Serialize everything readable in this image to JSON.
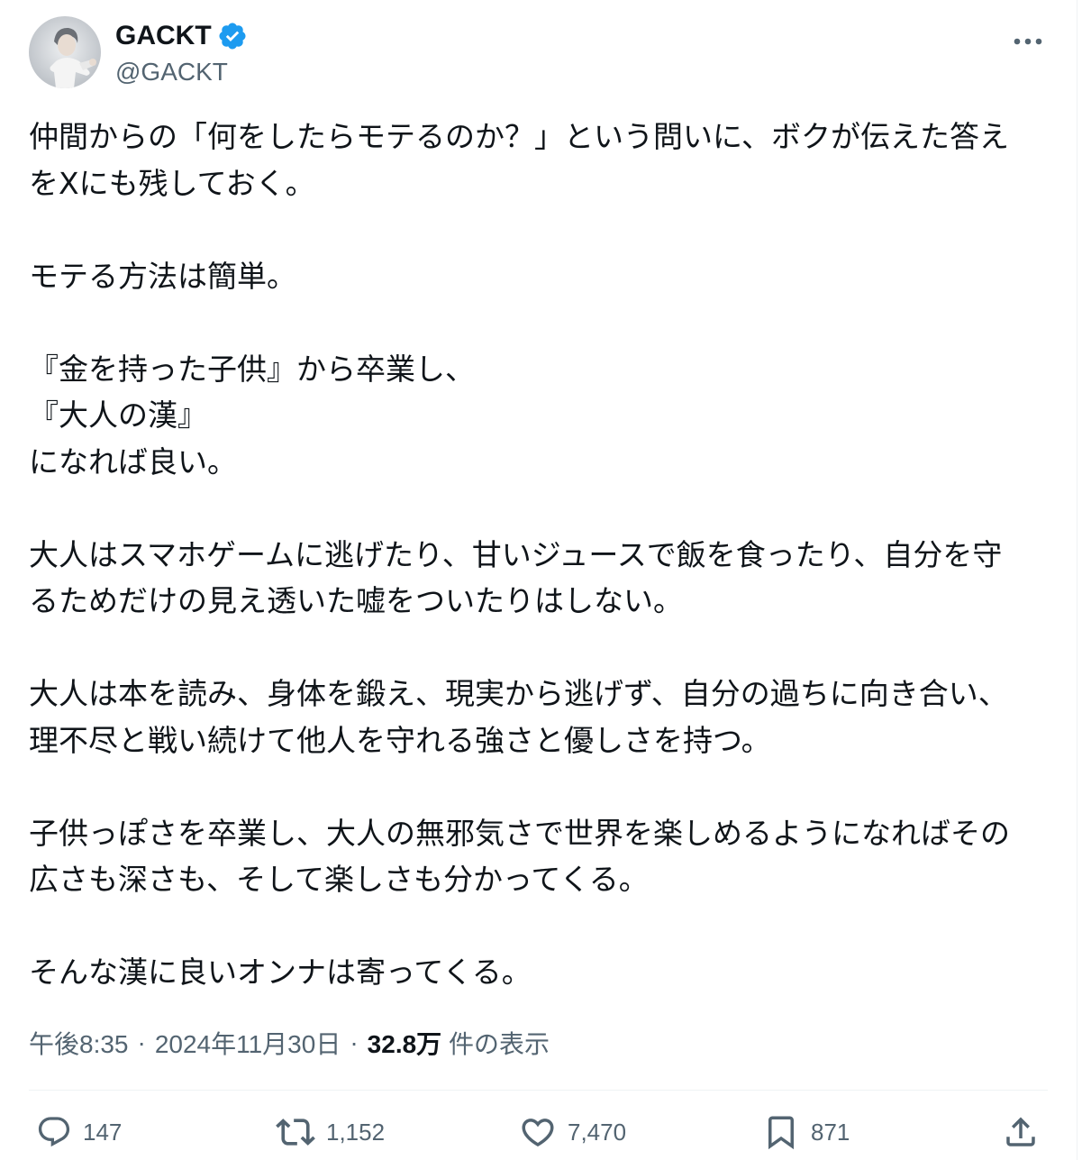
{
  "author": {
    "display_name": "GACKT",
    "handle": "@GACKT",
    "verified": true
  },
  "tweet": {
    "text": "仲間からの「何をしたらモテるのか？」という問いに、ボクが伝えた答え\nをXにも残しておく。\n\nモテる方法は簡単。\n\n『金を持った子供』から卒業し、\n『大人の漢』\nになれば良い。\n\n大人はスマホゲームに逃げたり、甘いジュースで飯を食ったり、自分を守\nるためだけの見え透いた嘘をついたりはしない。\n\n大人は本を読み、身体を鍛え、現実から逃げず、自分の過ちに向き合い、\n理不尽と戦い続けて他人を守れる強さと優しさを持つ。\n\n子供っぽさを卒業し、大人の無邪気さで世界を楽しめるようになればその\n広さも深さも、そして楽しさも分かってくる。\n\nそんな漢に良いオンナは寄ってくる。"
  },
  "meta": {
    "time": "午後8:35",
    "separator1": "·",
    "date": "2024年11月30日",
    "separator2": "·",
    "views_count": "32.8万",
    "views_label": "件の表示"
  },
  "actions": {
    "replies": "147",
    "reposts": "1,152",
    "likes": "7,470",
    "bookmarks": "871"
  },
  "icons": {
    "verified": "verified-badge-icon",
    "more": "more-dots-icon",
    "reply": "reply-icon",
    "repost": "repost-icon",
    "like": "heart-icon",
    "bookmark": "bookmark-icon",
    "share": "share-icon"
  },
  "colors": {
    "verified_blue": "#1d9bf0",
    "text_primary": "#0f1419",
    "text_secondary": "#536471",
    "divider": "#eff3f4"
  }
}
